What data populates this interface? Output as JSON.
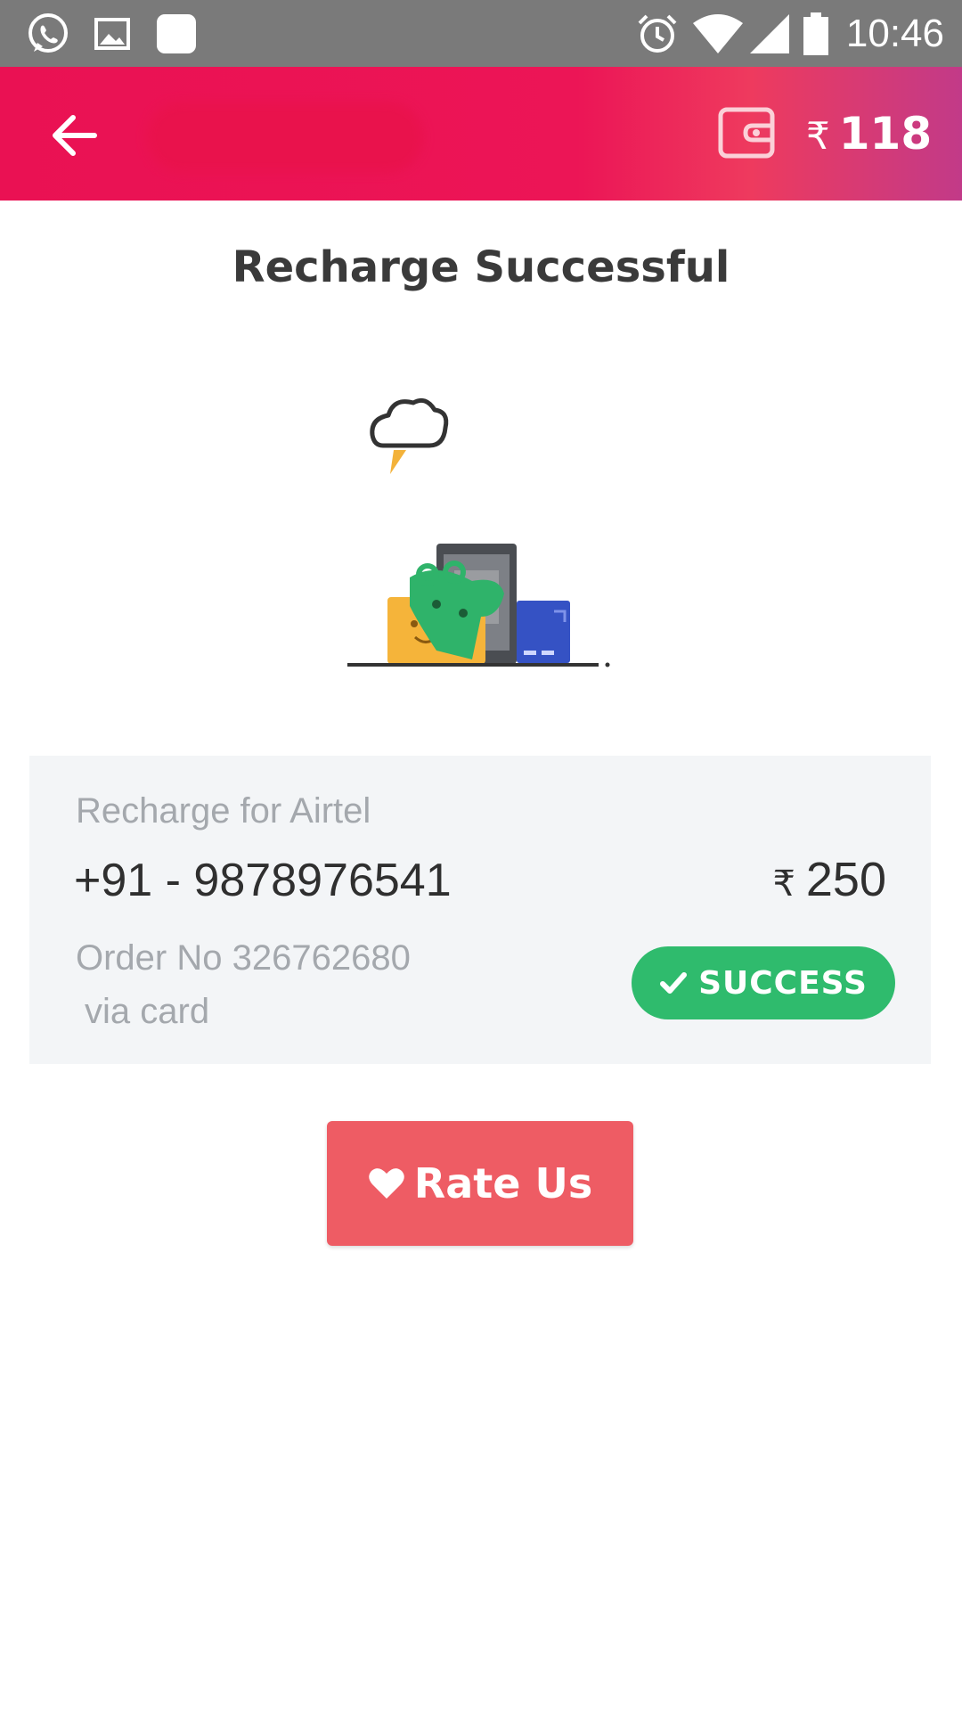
{
  "status_bar": {
    "time": "10:46",
    "icons": [
      "whatsapp-icon",
      "gallery-icon",
      "app-icon",
      "alarm-icon",
      "wifi-icon",
      "signal-icon",
      "battery-icon"
    ]
  },
  "header": {
    "back_icon": "back-arrow-icon",
    "wallet_icon": "wallet-icon",
    "currency_symbol": "₹",
    "wallet_balance": "118",
    "brand_color": "#ea1153"
  },
  "page": {
    "title": "Recharge Successful"
  },
  "recharge": {
    "operator_label": "Recharge for Airtel",
    "phone": "+91 - 9878976541",
    "currency_symbol": "₹",
    "amount": "250",
    "order": "Order No 326762680",
    "payment_method": "via card",
    "status": "SUCCESS",
    "status_color": "#2fbb6d"
  },
  "actions": {
    "rate_us_label": "Rate Us",
    "rate_us_color": "#ee5c64"
  }
}
